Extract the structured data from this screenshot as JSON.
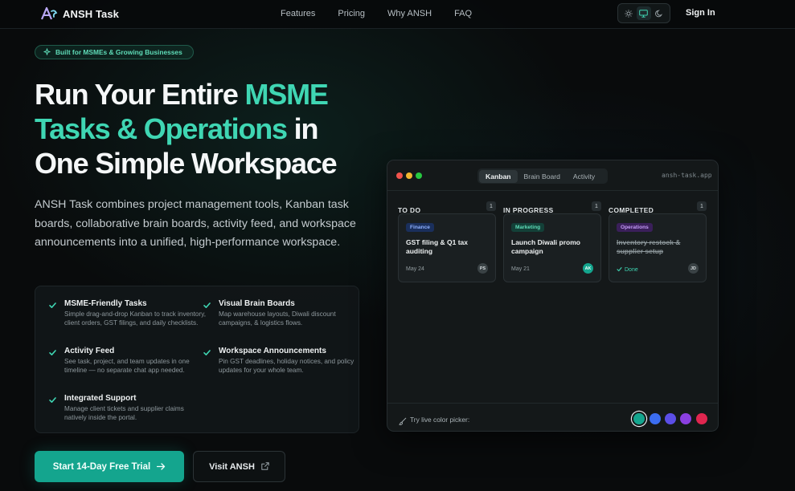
{
  "navbar": {
    "brand_name": "ANSH Task",
    "links": [
      "Features",
      "Pricing",
      "Why ANSH",
      "FAQ"
    ],
    "theme_icons": [
      "sun-icon",
      "monitor-icon",
      "moon-icon"
    ],
    "signin_label": "Sign In"
  },
  "hero": {
    "badge": "Built for MSMEs & Growing Businesses",
    "title_l1_plain": "Run Your Entire ",
    "title_l1_accent": "MSME",
    "title_l2_accent": "Tasks & Operations",
    "title_l2_plain": " in",
    "title_l3_plain": "One Simple Workspace",
    "description": "ANSH Task combines project management tools, Kanban task boards, collaborative brain boards, activity feed, and workspace announcements into a unified, high-performance workspace."
  },
  "features": [
    {
      "title": "MSME-Friendly Tasks",
      "desc": "Simple drag-and-drop Kanban to track inventory, client orders, GST filings, and daily checklists."
    },
    {
      "title": "Visual Brain Boards",
      "desc": "Map warehouse layouts, Diwali discount campaigns, & logistics flows."
    },
    {
      "title": "Activity Feed",
      "desc": "See task, project, and team updates in one timeline — no separate chat app needed."
    },
    {
      "title": "Workspace Announcements",
      "desc": "Pin GST deadlines, holiday notices, and policy updates for your whole team."
    },
    {
      "title": "Integrated Support",
      "desc": "Manage client tickets and supplier claims natively inside the portal."
    }
  ],
  "cta": {
    "primary_label": "Start 14-Day Free Trial",
    "secondary_label": "Visit ANSH"
  },
  "app_window": {
    "tabs": [
      "Kanban",
      "Brain Board",
      "Activity"
    ],
    "active_tab": "Kanban",
    "url": "ansh-task.app",
    "columns": [
      {
        "title": "TO DO",
        "count": "1",
        "card": {
          "tag": "Finance",
          "title": "GST filing & Q1 tax auditing",
          "date": "May 24",
          "avatar": "PS"
        }
      },
      {
        "title": "IN PROGRESS",
        "count": "1",
        "card": {
          "tag": "Marketing",
          "title": "Launch Diwali promo campaign",
          "date": "May 21",
          "avatar": "AK"
        }
      },
      {
        "title": "COMPLETED",
        "count": "1",
        "card": {
          "tag": "Operations",
          "title": "Inventory restock & supplier setup",
          "date": "Done",
          "avatar": "JD"
        }
      }
    ],
    "picker_label": "Try live color picker:",
    "swatch_colors": [
      "#14a58e",
      "#3b6df0",
      "#5b4ee6",
      "#8a3fe0",
      "#e0264f"
    ]
  },
  "colors": {
    "accent": "#3fd6b3",
    "primary_button": "#14a58e",
    "background": "#090b0c"
  }
}
